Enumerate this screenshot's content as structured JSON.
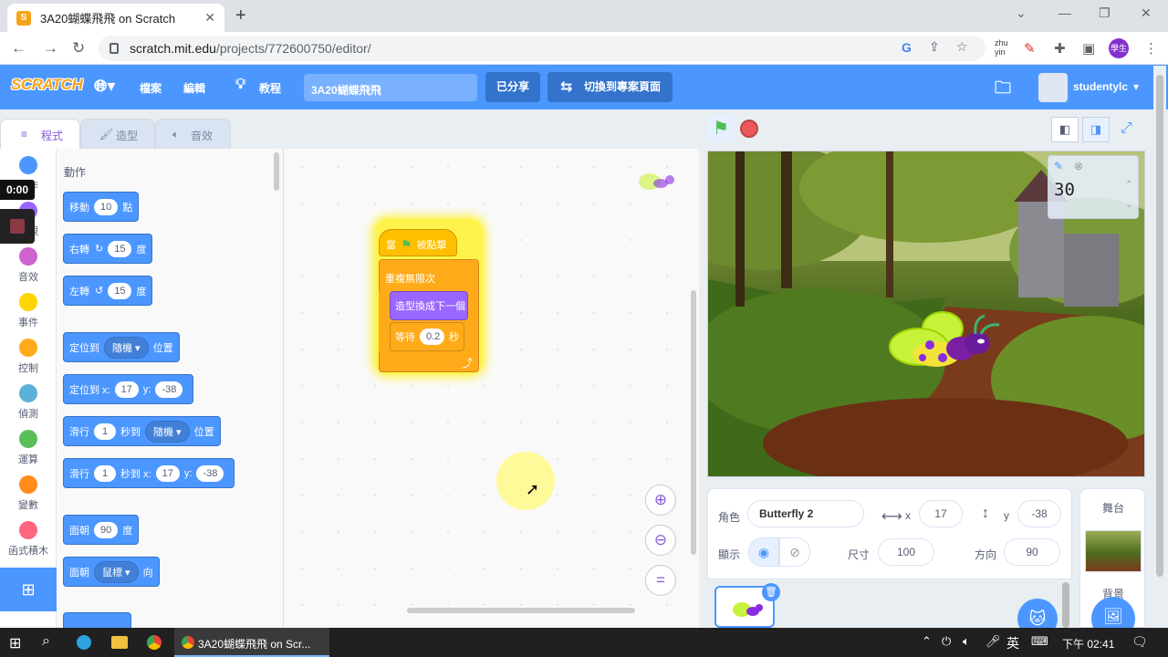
{
  "browser": {
    "tab_title": "3A20蝴蝶飛飛 on Scratch",
    "url_host": "scratch.mit.edu",
    "url_path": "/projects/772600750/editor/",
    "ime_label": "zhu\nyin",
    "profile_badge": "學生"
  },
  "menu": {
    "logo": "SCRATCH",
    "file": "檔案",
    "edit": "編輯",
    "tutorials": "教程",
    "project_title": "3A20蝴蝶飛飛",
    "shared": "已分享",
    "see_project_page": "切換到專案頁面",
    "username": "studentylc"
  },
  "editor_tabs": {
    "code": "程式",
    "costumes": "造型",
    "sounds": "音效"
  },
  "categories": [
    {
      "label": "動作",
      "color": "#4c97ff"
    },
    {
      "label": "外觀",
      "color": "#9966ff"
    },
    {
      "label": "音效",
      "color": "#cf63cf"
    },
    {
      "label": "事件",
      "color": "#ffd500"
    },
    {
      "label": "控制",
      "color": "#ffab19"
    },
    {
      "label": "偵測",
      "color": "#5cb1d6"
    },
    {
      "label": "運算",
      "color": "#59c059"
    },
    {
      "label": "變數",
      "color": "#ff8c1a"
    },
    {
      "label": "函式積木",
      "color": "#ff6680"
    }
  ],
  "palette": {
    "heading": "動作",
    "move": {
      "a": "移動",
      "v": "10",
      "b": "點"
    },
    "turn_right": {
      "a": "右轉",
      "v": "15",
      "b": "度"
    },
    "turn_left": {
      "a": "左轉",
      "v": "15",
      "b": "度"
    },
    "goto": {
      "a": "定位到",
      "dd": "隨機",
      "b": "位置"
    },
    "goto_xy": {
      "a": "定位到 x:",
      "x": "17",
      "y_lbl": "y:",
      "y": "-38"
    },
    "glide": {
      "a": "滑行",
      "v": "1",
      "b": "秒到",
      "dd": "隨機",
      "c": "位置"
    },
    "glide_xy": {
      "a": "滑行",
      "v": "1",
      "b": "秒到 x:",
      "x": "17",
      "y_lbl": "y:",
      "y": "-38"
    },
    "point_dir": {
      "a": "面朝",
      "v": "90",
      "b": "度"
    },
    "point_towards": {
      "a": "面朝",
      "dd": "鼠標",
      "b": "向"
    }
  },
  "script": {
    "hat_a": "當",
    "hat_b": "被點擊",
    "forever": "重複無限次",
    "next_costume": "造型換成下一個",
    "wait_a": "等待",
    "wait_v": "0.2",
    "wait_b": "秒"
  },
  "recording": {
    "timer": "0:00"
  },
  "monitor": {
    "value": "30"
  },
  "sprite_info": {
    "sprite_label": "角色",
    "sprite_name": "Butterfly 2",
    "x_label": "x",
    "x": "17",
    "y_label": "y",
    "y": "-38",
    "show_label": "顯示",
    "size_label": "尺寸",
    "size": "100",
    "direction_label": "方向",
    "direction": "90"
  },
  "stage_panel": {
    "title": "舞台",
    "backdrops_label": "背景"
  },
  "taskbar": {
    "app_label": "3A20蝴蝶飛飛 on Scr...",
    "lang": "英",
    "clock": "下午 02:41"
  }
}
